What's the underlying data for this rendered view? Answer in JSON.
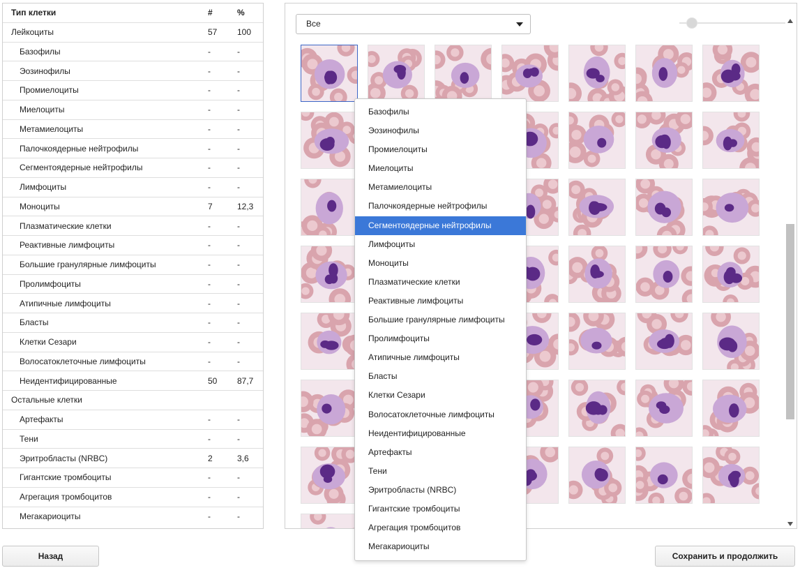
{
  "table": {
    "header": {
      "name": "Тип клетки",
      "count": "#",
      "percent": "%"
    },
    "rows": [
      {
        "name": "Лейкоциты",
        "count": "57",
        "percent": "100",
        "level": 0
      },
      {
        "name": "Базофилы",
        "count": "-",
        "percent": "-",
        "level": 1
      },
      {
        "name": "Эозинофилы",
        "count": "-",
        "percent": "-",
        "level": 1
      },
      {
        "name": "Промиелоциты",
        "count": "-",
        "percent": "-",
        "level": 1
      },
      {
        "name": "Миелоциты",
        "count": "-",
        "percent": "-",
        "level": 1
      },
      {
        "name": "Метамиелоциты",
        "count": "-",
        "percent": "-",
        "level": 1
      },
      {
        "name": "Палочкоядерные нейтрофилы",
        "count": "-",
        "percent": "-",
        "level": 1
      },
      {
        "name": "Сегментоядерные нейтрофилы",
        "count": "-",
        "percent": "-",
        "level": 1
      },
      {
        "name": "Лимфоциты",
        "count": "-",
        "percent": "-",
        "level": 1
      },
      {
        "name": "Моноциты",
        "count": "7",
        "percent": "12,3",
        "level": 1
      },
      {
        "name": "Плазматические клетки",
        "count": "-",
        "percent": "-",
        "level": 1
      },
      {
        "name": "Реактивные лимфоциты",
        "count": "-",
        "percent": "-",
        "level": 1
      },
      {
        "name": "Большие гранулярные лимфоциты",
        "count": "-",
        "percent": "-",
        "level": 1
      },
      {
        "name": "Пролимфоциты",
        "count": "-",
        "percent": "-",
        "level": 1
      },
      {
        "name": "Атипичные лимфоциты",
        "count": "-",
        "percent": "-",
        "level": 1
      },
      {
        "name": "Бласты",
        "count": "-",
        "percent": "-",
        "level": 1
      },
      {
        "name": "Клетки Сезари",
        "count": "-",
        "percent": "-",
        "level": 1
      },
      {
        "name": "Волосатоклеточные лимфоциты",
        "count": "-",
        "percent": "-",
        "level": 1
      },
      {
        "name": "Неидентифицированные",
        "count": "50",
        "percent": "87,7",
        "level": 1
      },
      {
        "name": "Остальные клетки",
        "count": "",
        "percent": "",
        "level": 0
      },
      {
        "name": "Артефакты",
        "count": "-",
        "percent": "-",
        "level": 1
      },
      {
        "name": "Тени",
        "count": "-",
        "percent": "-",
        "level": 1
      },
      {
        "name": "Эритробласты (NRBC)",
        "count": "2",
        "percent": "3,6",
        "level": 1
      },
      {
        "name": "Гигантские тромбоциты",
        "count": "-",
        "percent": "-",
        "level": 1
      },
      {
        "name": "Агрегация тромбоцитов",
        "count": "-",
        "percent": "-",
        "level": 1
      },
      {
        "name": "Мегакариоциты",
        "count": "-",
        "percent": "-",
        "level": 1
      }
    ]
  },
  "filter": {
    "selected": "Все"
  },
  "dropdown": {
    "highlighted_index": 6,
    "items": [
      "Базофилы",
      "Эозинофилы",
      "Промиелоциты",
      "Миелоциты",
      "Метамиелоциты",
      "Палочкоядерные нейтрофилы",
      "Сегментоядерные нейтрофилы",
      "Лимфоциты",
      "Моноциты",
      "Плазматические клетки",
      "Реактивные лимфоциты",
      "Большие гранулярные лимфоциты",
      "Пролимфоциты",
      "Атипичные лимфоциты",
      "Бласты",
      "Клетки Сезари",
      "Волосатоклеточные лимфоциты",
      "Неидентифицированные",
      "Артефакты",
      "Тени",
      "Эритробласты (NRBC)",
      "Гигантские тромбоциты",
      "Агрегация тромбоцитов",
      "Мегакариоциты"
    ]
  },
  "gallery": {
    "rows": 7,
    "cols": 7,
    "partial_row_cells": 1,
    "selected_index": 0
  },
  "colors": {
    "background": "#f3e6ec",
    "rbc": "#d9a4ad",
    "rbc_center": "#ecc9cf",
    "cytoplasm": "#c9a7d6",
    "nucleus": "#5b2a86",
    "highlight": "#3b78d8"
  },
  "buttons": {
    "back": "Назад",
    "save": "Сохранить и продолжить"
  }
}
